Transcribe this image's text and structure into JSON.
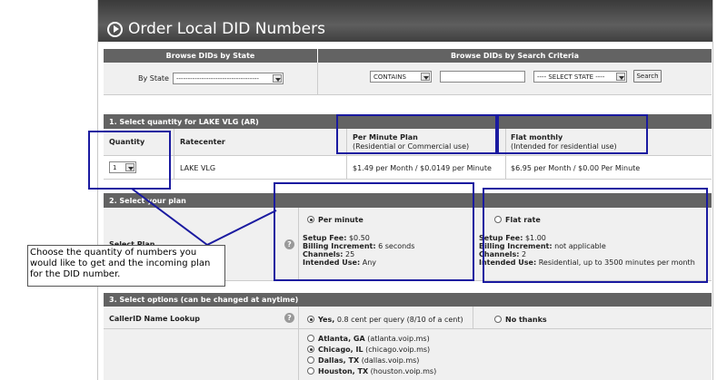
{
  "title": "Order Local DID Numbers",
  "browse": {
    "by_state_header": "Browse DIDs by State",
    "by_criteria_header": "Browse DIDs by Search Criteria",
    "by_state_label": "By State",
    "state_select_value": "------------------------------------",
    "contains_value": "CONTAINS",
    "criteria_state_value": "---- SELECT STATE ----",
    "search_button": "Search"
  },
  "section1": {
    "header": "1. Select quantity for LAKE VLG (AR)",
    "col_quantity": "Quantity",
    "col_ratecenter": "Ratecenter",
    "col_per_minute": "Per Minute Plan",
    "col_per_minute_sub": "(Residential or Commercial use)",
    "col_flat": "Flat monthly",
    "col_flat_sub": "(Intended for residential use)",
    "quantity_value": "1",
    "ratecenter": "LAKE VLG",
    "per_minute_price": "$1.49 per Month / $0.0149 per Minute",
    "flat_price": "$6.95 per Month / $0.00 Per Minute"
  },
  "section2": {
    "header": "2. Select your plan",
    "select_plan_label": "Select Plan",
    "per_minute": {
      "label": "Per minute",
      "setup_fee_label": "Setup Fee:",
      "setup_fee": "$0.50",
      "billing_label": "Billing Increment:",
      "billing": "6 seconds",
      "channels_label": "Channels:",
      "channels": "25",
      "use_label": "Intended Use:",
      "use": "Any"
    },
    "flat": {
      "label": "Flat rate",
      "setup_fee_label": "Setup Fee:",
      "setup_fee": "$1.00",
      "billing_label": "Billing Increment:",
      "billing": "not applicable",
      "channels_label": "Channels:",
      "channels": "2",
      "use_label": "Intended Use:",
      "use": "Residential, up to 3500 minutes per month"
    }
  },
  "section3": {
    "header": "3. Select options (can be changed at anytime)",
    "callerid_label": "CallerID Name Lookup",
    "yes_label": "Yes,",
    "yes_detail": "0.8 cent per query (8/10 of a cent)",
    "no_label": "No thanks",
    "servers": [
      {
        "name": "Atlanta, GA",
        "host": "(atlanta.voip.ms)"
      },
      {
        "name": "Chicago, IL",
        "host": "(chicago.voip.ms)"
      },
      {
        "name": "Dallas, TX",
        "host": "(dallas.voip.ms)"
      },
      {
        "name": "Houston, TX",
        "host": "(houston.voip.ms)"
      }
    ]
  },
  "help_glyph": "?",
  "callout": "Choose the quantity of numbers you would like to get and the incoming plan for the DID number."
}
